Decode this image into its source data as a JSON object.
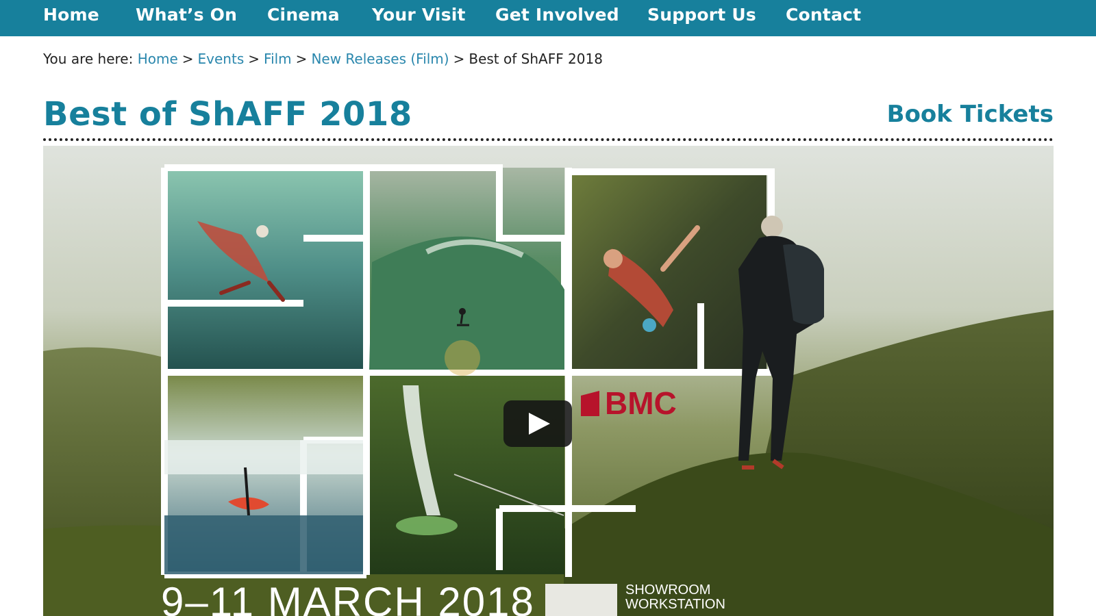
{
  "nav": {
    "items": [
      {
        "label": "Home"
      },
      {
        "label": "What’s On"
      },
      {
        "label": "Cinema"
      },
      {
        "label": "Your Visit"
      },
      {
        "label": "Get Involved"
      },
      {
        "label": "Support Us"
      },
      {
        "label": "Contact"
      }
    ]
  },
  "breadcrumb": {
    "prefix": "You are here:",
    "separator": ">",
    "links": [
      "Home",
      "Events",
      "Film",
      "New Releases (Film)"
    ],
    "current": "Best of ShAFF 2018"
  },
  "page": {
    "title": "Best of ShAFF 2018",
    "book_label": "Book Tickets"
  },
  "video": {
    "play_icon": "play-icon",
    "sponsor_logo_text": "BMC",
    "poster_date": "9–11 MARCH 2018",
    "venue_line_1": "SHOWROOM",
    "venue_line_2": "WORKSTATION"
  },
  "colors": {
    "brand": "#17809c",
    "link": "#2a87ad",
    "logo_red": "#b7132b"
  }
}
